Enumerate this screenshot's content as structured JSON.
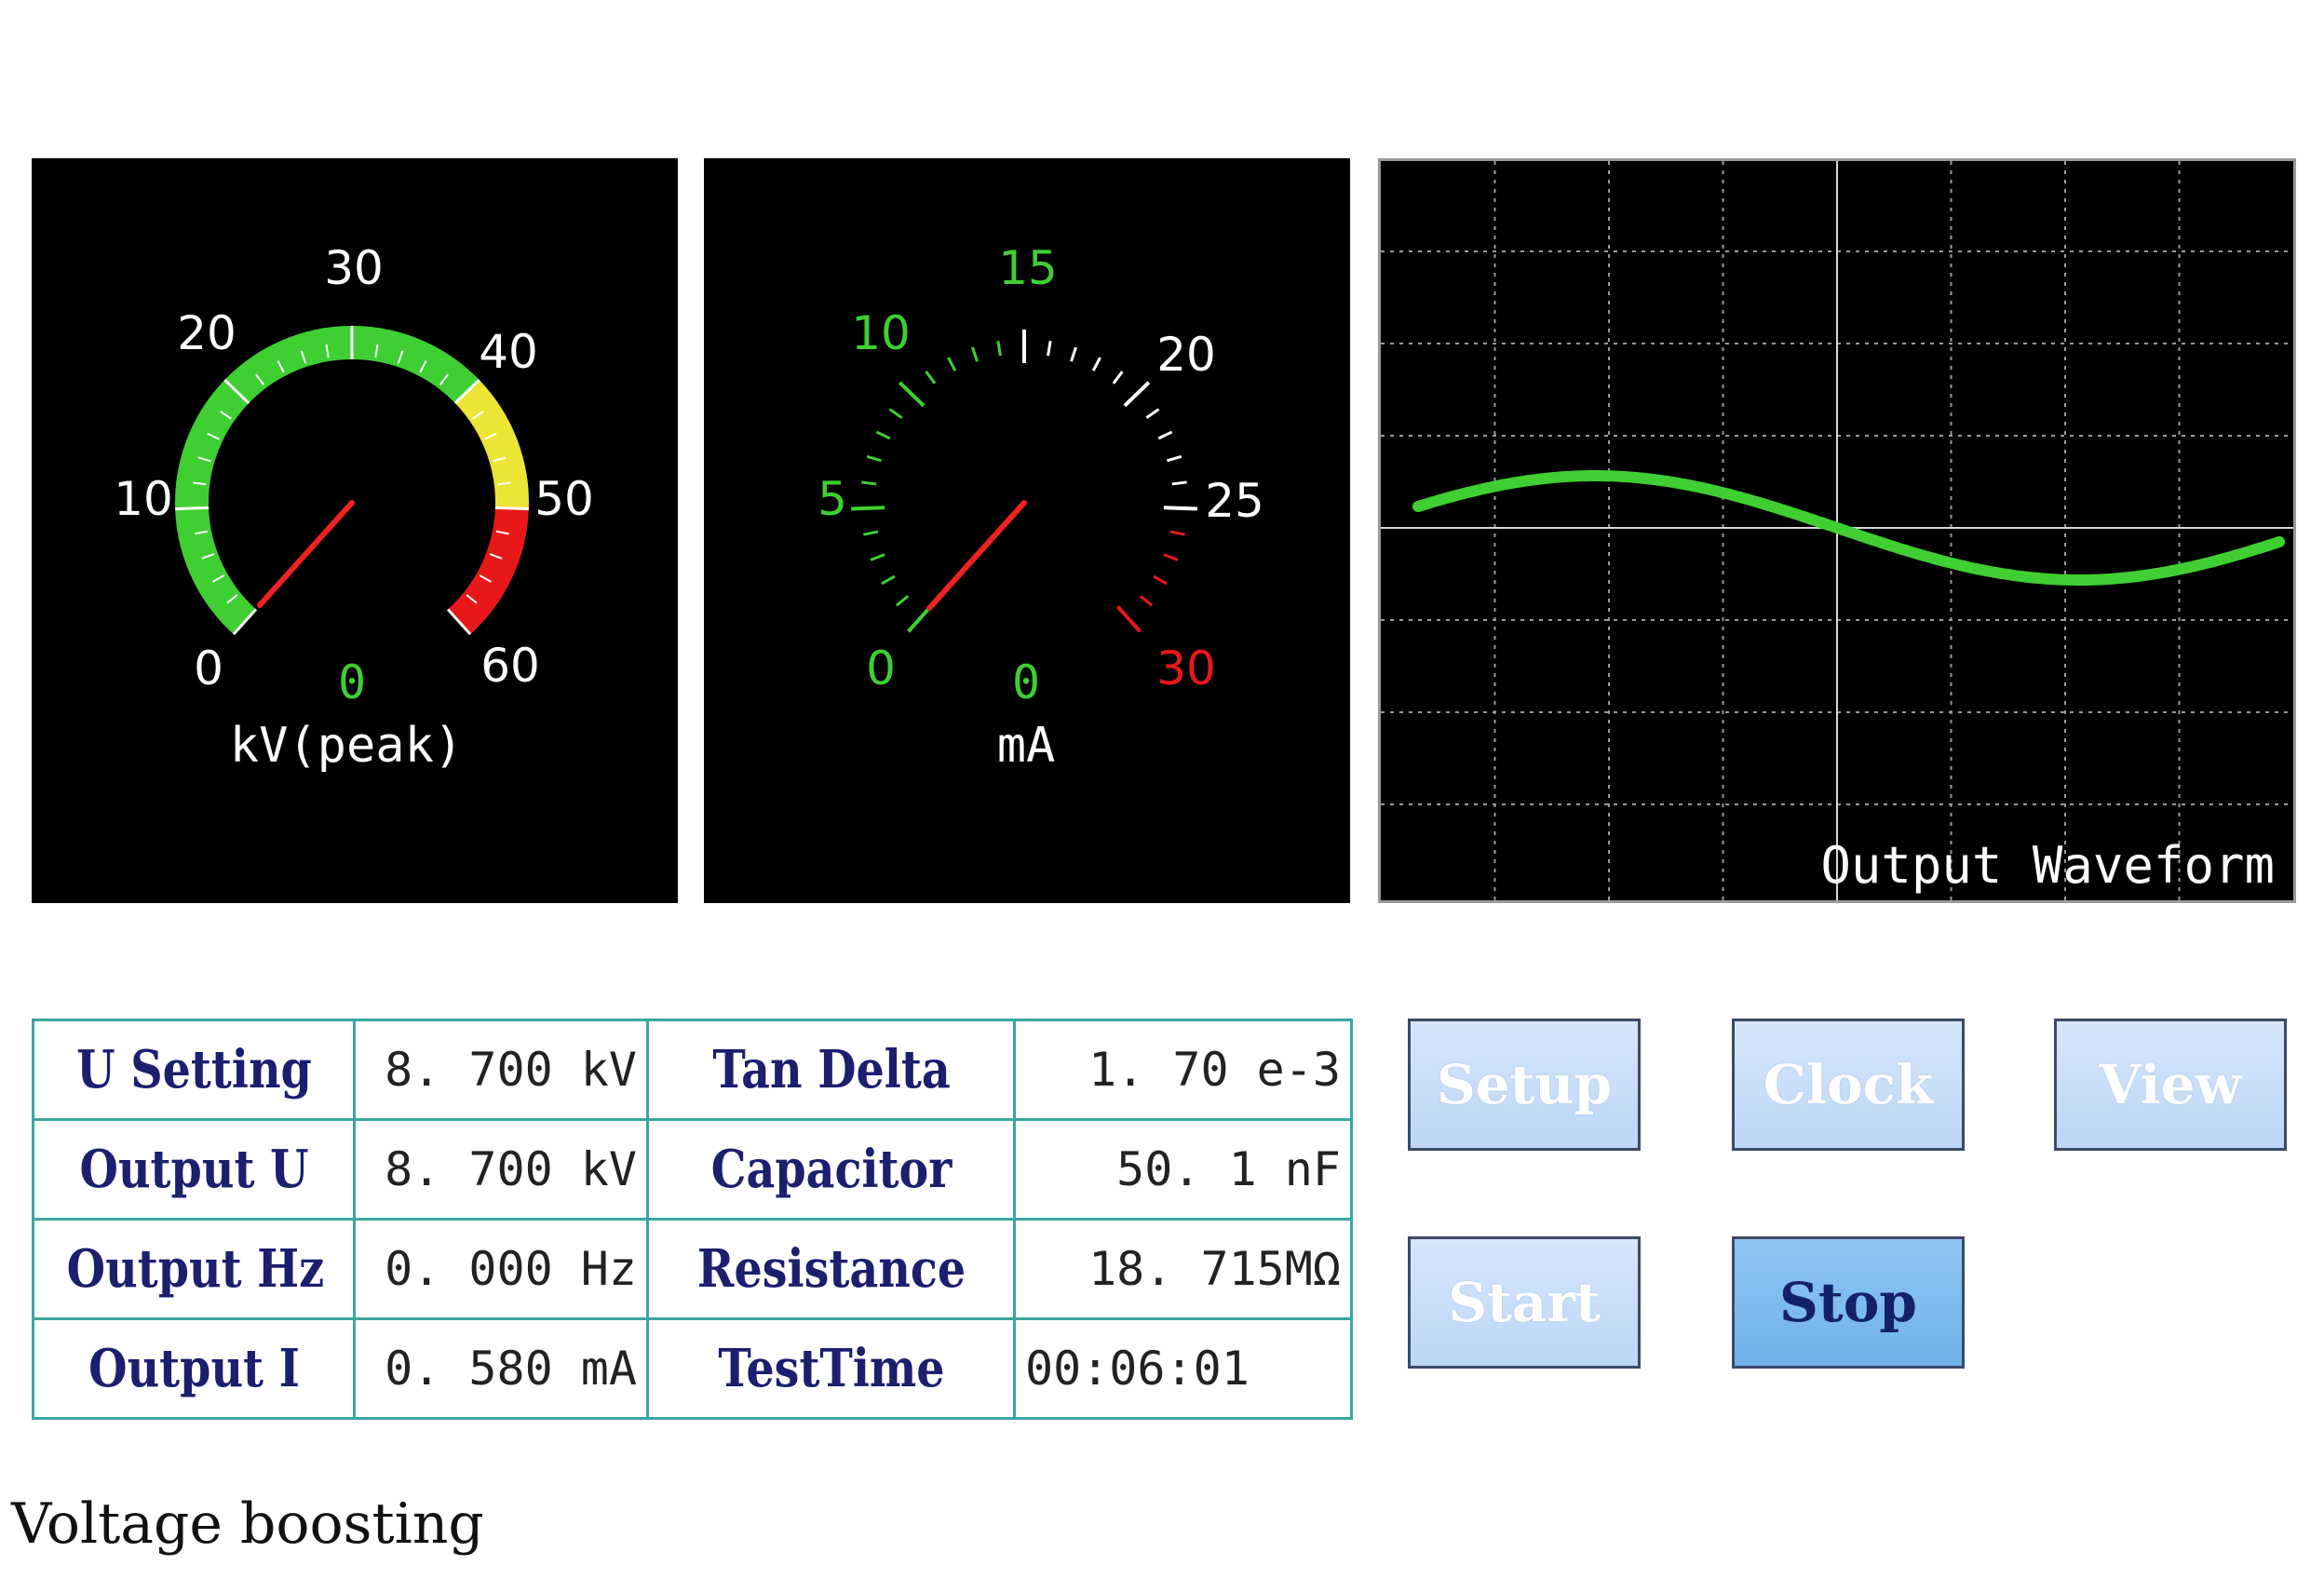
{
  "colors": {
    "green": "#3fcf33",
    "yellow": "#ece535",
    "red": "#e81818",
    "needle": "#ee2222",
    "table_border": "#3aa6a0",
    "label_text": "#1a1f6e",
    "button_fill": "#c8defa",
    "button_active_fill": "#7fbbef"
  },
  "voltage_gauge": {
    "ticks": [
      "0",
      "10",
      "20",
      "30",
      "40",
      "50",
      "60"
    ],
    "readout": "0",
    "unit": "kV(peak)",
    "min": 0,
    "max": 60,
    "value": 0,
    "zones": [
      {
        "from": 0,
        "to": 40,
        "color": "green"
      },
      {
        "from": 40,
        "to": 50,
        "color": "yellow"
      },
      {
        "from": 50,
        "to": 60,
        "color": "red"
      }
    ]
  },
  "current_gauge": {
    "ticks": [
      "0",
      "5",
      "10",
      "15",
      "20",
      "25",
      "30"
    ],
    "readout": "0",
    "unit": "mA",
    "min": 0,
    "max": 30,
    "value": 0
  },
  "waveform": {
    "title": "Output Waveform"
  },
  "table": {
    "rows": [
      {
        "label1": "U Setting",
        "value1": "8. 700 kV",
        "label2": "Tan Delta",
        "value2": "1. 70 e-3"
      },
      {
        "label1": "Output U",
        "value1": "8. 700 kV",
        "label2": "Capacitor",
        "value2": "50. 1 nF"
      },
      {
        "label1": "Output Hz",
        "value1": "0. 000 Hz",
        "label2": "Resistance",
        "value2": "18. 715MΩ"
      },
      {
        "label1": "Output I",
        "value1": "0. 580 mA",
        "label2": "TestTime",
        "value2": "00:06:01"
      }
    ]
  },
  "buttons": {
    "setup": "Setup",
    "clock": "Clock",
    "view": "View",
    "start": "Start",
    "stop": "Stop"
  },
  "caption": "Voltage boosting"
}
